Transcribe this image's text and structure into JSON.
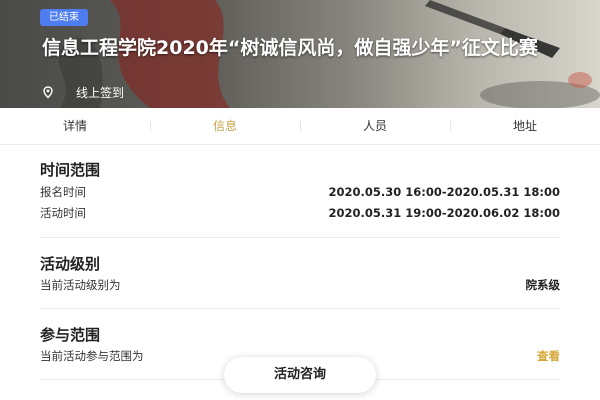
{
  "hero": {
    "status_badge": "已结束",
    "title": "信息工程学院2020年“树诚信风尚，做自强少年”征文比赛",
    "location_icon": "location-pin-icon",
    "location": "线上签到"
  },
  "tabs": [
    {
      "label": "详情"
    },
    {
      "label": "信息",
      "active": true
    },
    {
      "label": "人员"
    },
    {
      "label": "地址"
    }
  ],
  "time": {
    "heading": "时间范围",
    "rows": [
      {
        "label": "报名时间",
        "value": "2020.05.30 16:00-2020.05.31 18:00"
      },
      {
        "label": "活动时间",
        "value": "2020.05.31 19:00-2020.06.02 18:00"
      }
    ]
  },
  "level": {
    "heading": "活动级别",
    "label": "当前活动级别为",
    "value": "院系级"
  },
  "scope": {
    "heading": "参与范围",
    "label": "当前活动参与范围为",
    "link": "查看"
  },
  "consult_button": "活动咨询",
  "colors": {
    "accent": "#c9a24a",
    "badge": "#4f7cf0"
  }
}
